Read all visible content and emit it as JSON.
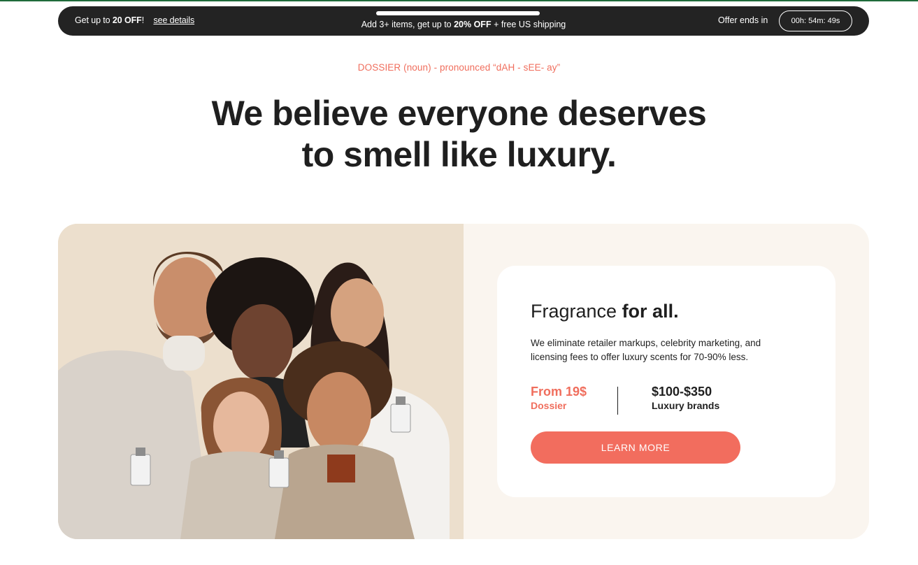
{
  "promo": {
    "left_prefix": "Get up to ",
    "left_bold": "20 OFF",
    "left_suffix": "!",
    "details_link": "see details",
    "center_prefix": "Add 3+ items, get up to ",
    "center_bold": "20% OFF",
    "center_suffix": " + free US shipping",
    "progress_fraction": 1.0,
    "offer_label": "Offer ends in",
    "timer": "00h: 54m: 49s"
  },
  "hero": {
    "pronunciation": "DOSSIER (noun) - pronounced “dAH - sEE- ay”",
    "headline_line1": "We believe everyone deserves",
    "headline_prefix": "to ",
    "headline_bold": "smell like luxury."
  },
  "feature": {
    "title_regular": "Fragrance ",
    "title_bold": "for all.",
    "description": "We eliminate retailer markups, celebrity marketing, and licensing fees to offer luxury scents for 70-90% less.",
    "stat_dossier_value": "From 19$",
    "stat_dossier_label": "Dossier",
    "stat_luxury_value": "$100-$350",
    "stat_luxury_label": "Luxury brands",
    "cta_label": "LEARN MORE"
  },
  "colors": {
    "accent": "#f26d5e",
    "dark_bar": "#232323",
    "panel_bg": "#faf5ef",
    "photo_bg": "#ecdfcd"
  }
}
